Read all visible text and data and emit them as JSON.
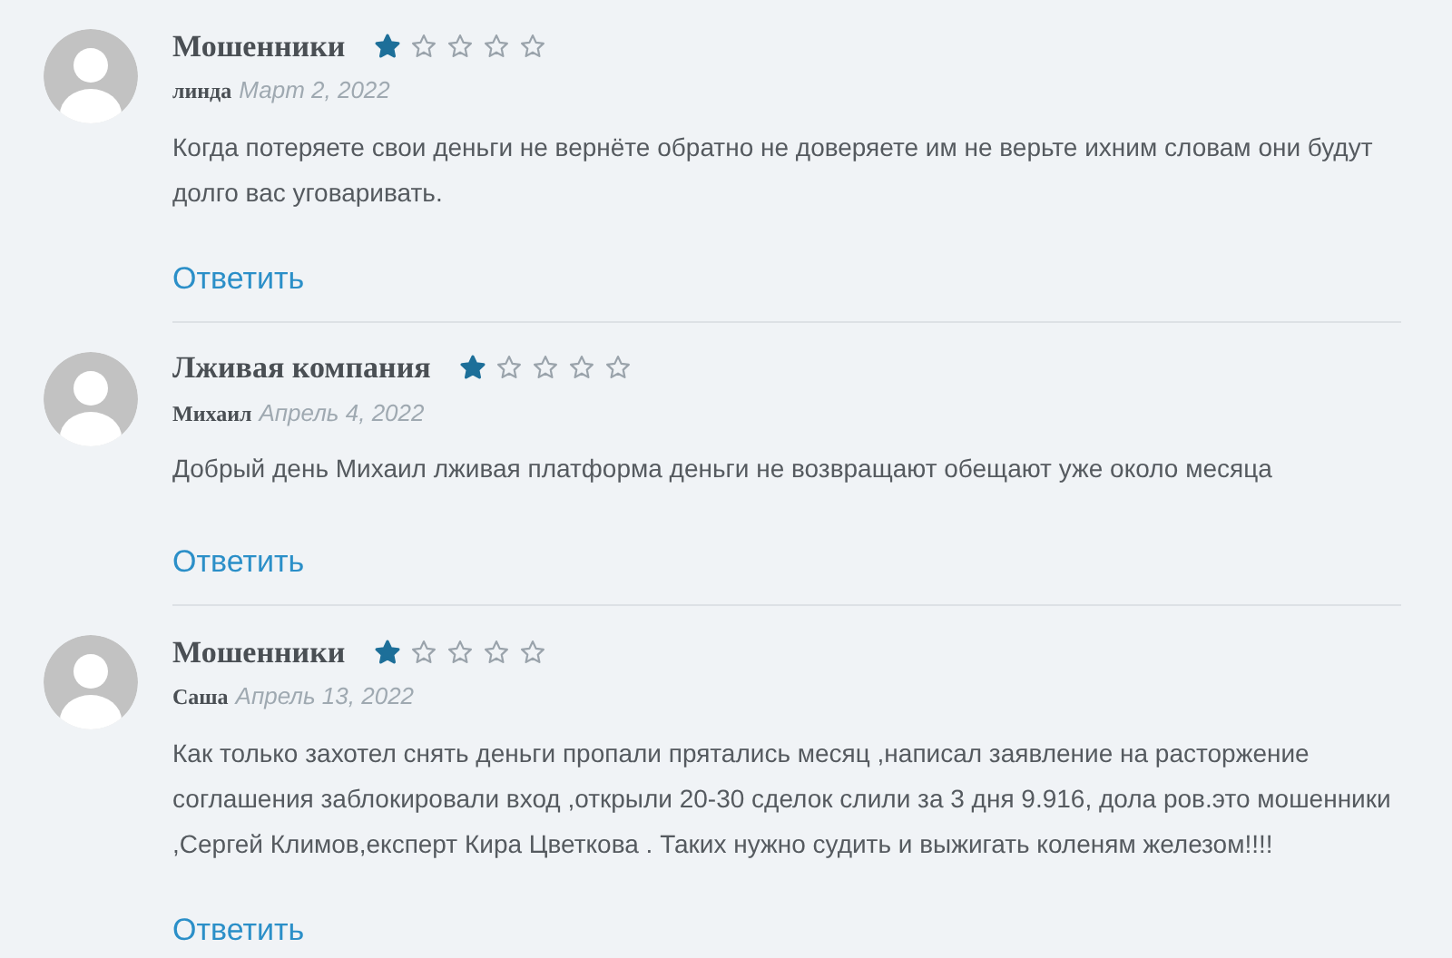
{
  "comments": [
    {
      "title": "Мошенники",
      "stars": 1,
      "author": "линда",
      "date": "Март 2, 2022",
      "lines": [
        "Когда потеряете свои деньги не вернёте обратно не доверяете им не верьте ихним словам они будут",
        "долго вас уговаривать."
      ],
      "reply": "Ответить"
    },
    {
      "title": "Лживая компания",
      "stars": 1,
      "author": "Михаил",
      "date": "Апрель 4, 2022",
      "lines": [
        "Добрый день Михаил лживая платформа деньги не возвращают обещают уже около месяца"
      ],
      "reply": "Ответить"
    },
    {
      "title": "Мошенники",
      "stars": 1,
      "author": "Саша",
      "date": "Апрель 13, 2022",
      "lines": [
        "Как только захотел снять деньги пропали прятались месяц ,написал заявление на расторжение",
        "соглашения заблокировали вход ,открыли 20-30 сделок слили за 3 дня 9.916, дола ров.это мошенники",
        ",Сергей Климов,експерт Кира Цветкова . Таких нужно судить и выжигать коленям железом!!!!"
      ],
      "reply": "Ответить"
    }
  ]
}
